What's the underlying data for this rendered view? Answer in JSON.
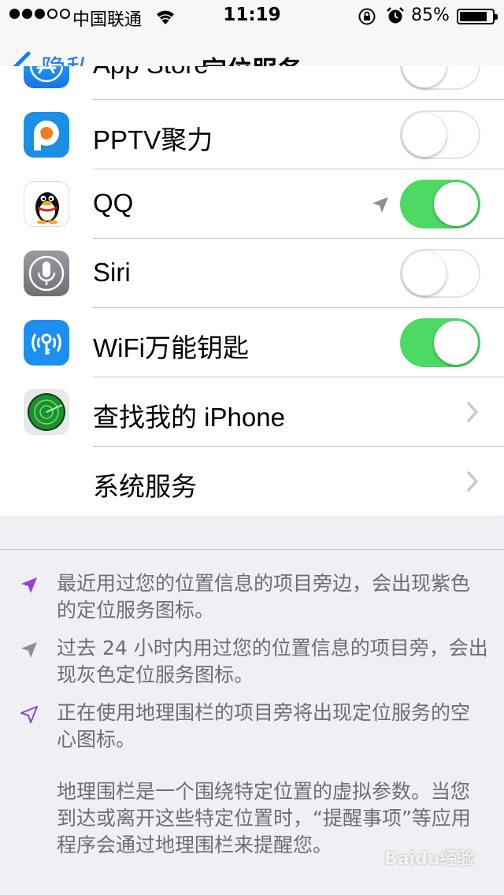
{
  "status_bar": {
    "carrier": "中国联通",
    "time": "11:19",
    "battery_percent_label": "85%",
    "battery_level": 0.85
  },
  "nav": {
    "back_label": "隐私",
    "title": "定位服务"
  },
  "apps": [
    {
      "label": "App Store",
      "toggle": "off",
      "icon": "app-store-icon"
    },
    {
      "label": "PPTV聚力",
      "toggle": "off",
      "icon": "pptv-icon"
    },
    {
      "label": "QQ",
      "toggle": "on",
      "icon": "qq-penguin-icon",
      "location_arrow": "gray"
    },
    {
      "label": "Siri",
      "toggle": "off",
      "icon": "siri-microphone-icon"
    },
    {
      "label": "WiFi万能钥匙",
      "toggle": "on",
      "icon": "wifi-key-icon"
    },
    {
      "label": "查找我的 iPhone",
      "control": "disclosure",
      "icon": "find-my-iphone-radar-icon"
    },
    {
      "label": "系统服务",
      "control": "disclosure"
    }
  ],
  "notes": {
    "purple": "最近用过您的位置信息的项目旁边，会出现紫色的定位服务图标。",
    "gray": "过去 24 小时内用过您的位置信息的项目旁，会出现灰色定位服务图标。",
    "outline": "正在使用地理围栏的项目旁将出现定位服务的空心图标。",
    "geofence": "地理围栏是一个围绕特定位置的虚拟参数。当您到达或离开这些特定位置时，“提醒事项”等应用程序会通过地理围栏来提醒您。"
  },
  "watermark": "Baidu经验",
  "colors": {
    "accent_blue": "#1a7cf5",
    "toggle_on": "#4cd964",
    "purple_arrow": "#8e44d6",
    "gray_arrow": "#8e8e93"
  }
}
